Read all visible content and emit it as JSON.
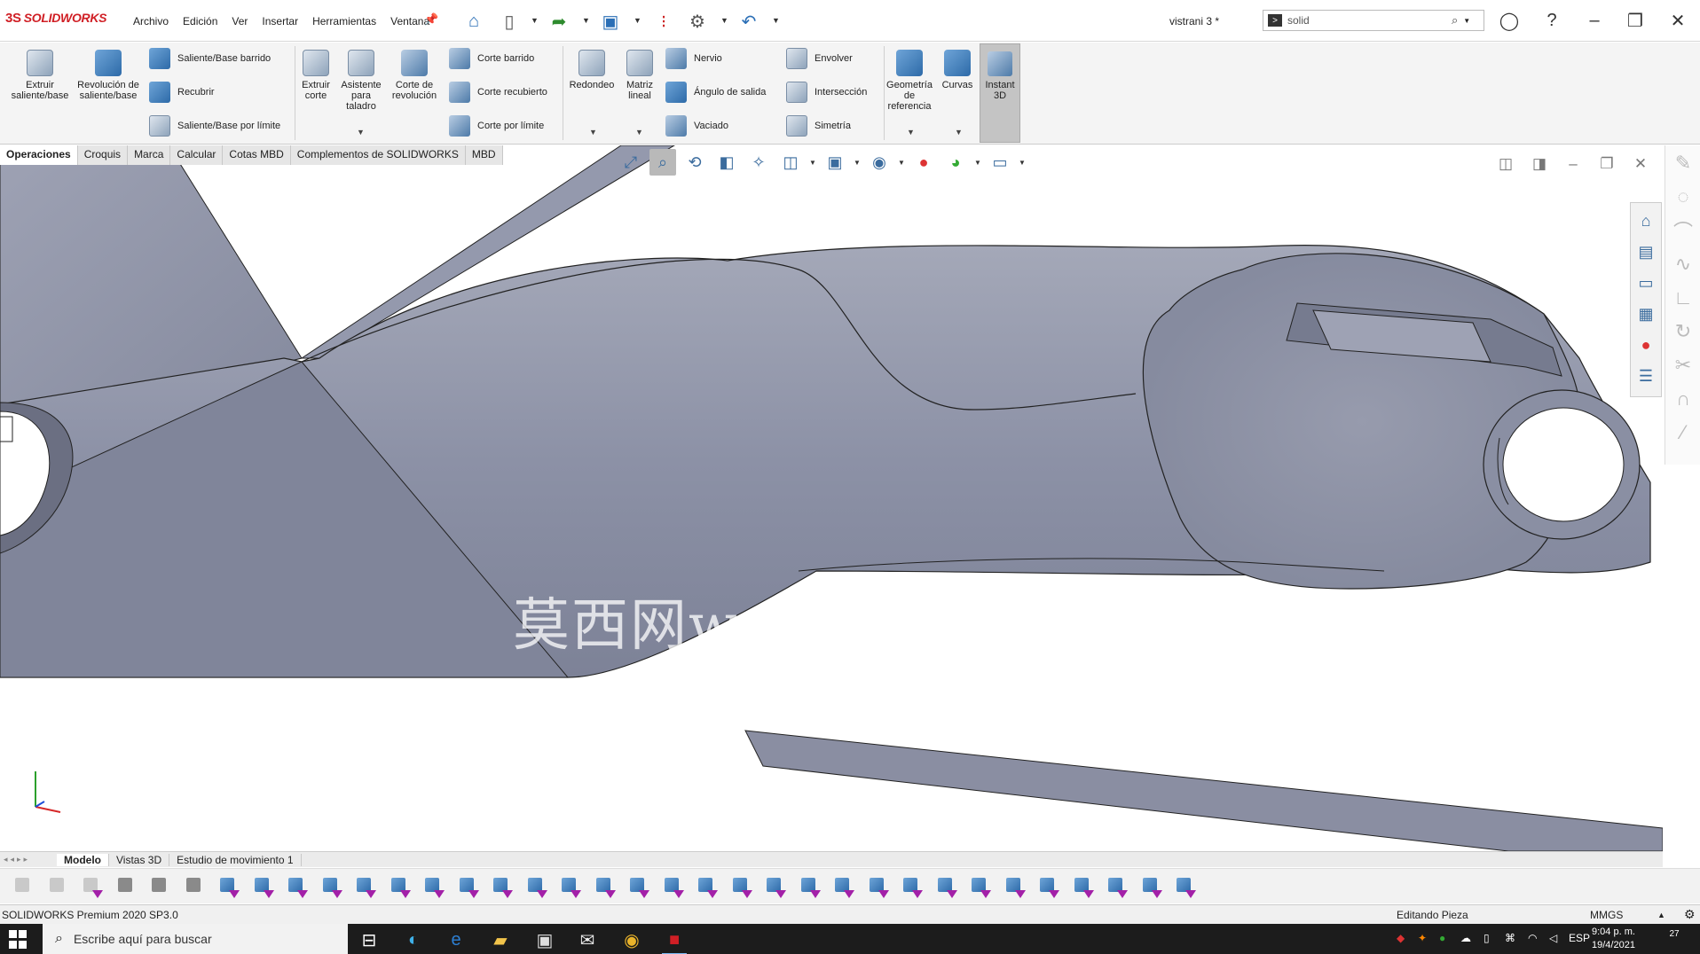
{
  "app": {
    "logo_text": "SOLIDWORKS",
    "logo_mark": "3S",
    "document_title": "vistrani 3 *",
    "menus": [
      "Archivo",
      "Edición",
      "Ver",
      "Insertar",
      "Herramientas",
      "Ventana"
    ],
    "search": {
      "value": "solid",
      "placeholder": ""
    }
  },
  "ribbon": {
    "features": {
      "extrude_boss": "Extruir saliente/base",
      "revolve_boss": "Revolución de saliente/base",
      "swept_boss": "Saliente/Base barrido",
      "loft_boss": "Recubrir",
      "boundary_boss": "Saliente/Base por límite",
      "extrude_cut": "Extruir corte",
      "hole_wizard": "Asistente para taladro",
      "revolve_cut": "Corte de revolución",
      "swept_cut": "Corte barrido",
      "loft_cut": "Corte recubierto",
      "boundary_cut": "Corte por límite",
      "fillet": "Redondeo",
      "linear_pattern": "Matriz lineal",
      "rib": "Nervio",
      "draft": "Ángulo de salida",
      "shell": "Vaciado",
      "wrap": "Envolver",
      "intersect": "Intersección",
      "mirror": "Simetría",
      "ref_geometry": "Geometría de referencia",
      "curves": "Curvas",
      "instant3d": "Instant 3D"
    }
  },
  "tabs": [
    "Operaciones",
    "Croquis",
    "Marca",
    "Calcular",
    "Cotas MBD",
    "Complementos de SOLIDWORKS",
    "MBD"
  ],
  "viewport": {
    "watermark": "莫西网www. 3dmox. com"
  },
  "bottom_tabs": [
    "Modelo",
    "Vistas 3D",
    "Estudio de movimiento 1"
  ],
  "status": {
    "product": "SOLIDWORKS Premium 2020 SP3.0",
    "mode": "Editando Pieza",
    "units": "MMGS"
  },
  "taskbar": {
    "search_placeholder": "Escribe aquí para buscar",
    "language": "ESP",
    "time": "9:04 p. m.",
    "date": "19/4/2021",
    "notifications": "27"
  },
  "colors": {
    "accent": "#d01f25",
    "model_surface": "#8e93a8",
    "ribbon_bg": "#f4f4f4",
    "instant3d_active": "#c4c4c4"
  }
}
